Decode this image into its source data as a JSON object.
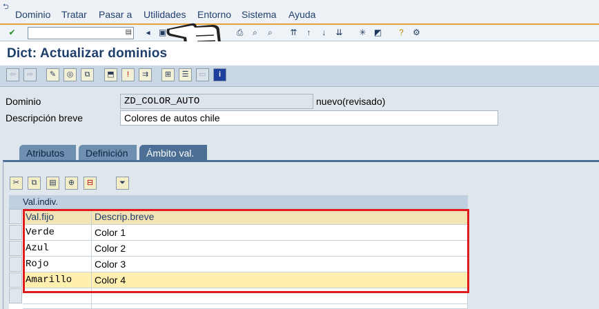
{
  "menu": [
    "Dominio",
    "Tratar",
    "Pasar a",
    "Utilidades",
    "Entorno",
    "Sistema",
    "Ayuda"
  ],
  "title": "Dict: Actualizar dominios",
  "fields": {
    "dominio_label": "Dominio",
    "dominio_value": "ZD_COLOR_AUTO",
    "dominio_status": "nuevo(revisado)",
    "descripcion_label": "Descripción breve",
    "descripcion_value": "Colores de autos chile"
  },
  "tabs": [
    "Atributos",
    "Definición",
    "Ámbito val."
  ],
  "grid": {
    "title": "Val.indiv.",
    "columns": [
      "Val.fijo",
      "Descrip.breve"
    ],
    "rows": [
      [
        "Verde",
        "Color 1"
      ],
      [
        "Azul",
        "Color 2"
      ],
      [
        "Rojo",
        "Color 3"
      ],
      [
        "Amarillo",
        "Color 4"
      ]
    ]
  },
  "colors": {
    "accent": "#e8a23b",
    "highlight": "#e01b1b",
    "title": "#1e3e6b"
  }
}
